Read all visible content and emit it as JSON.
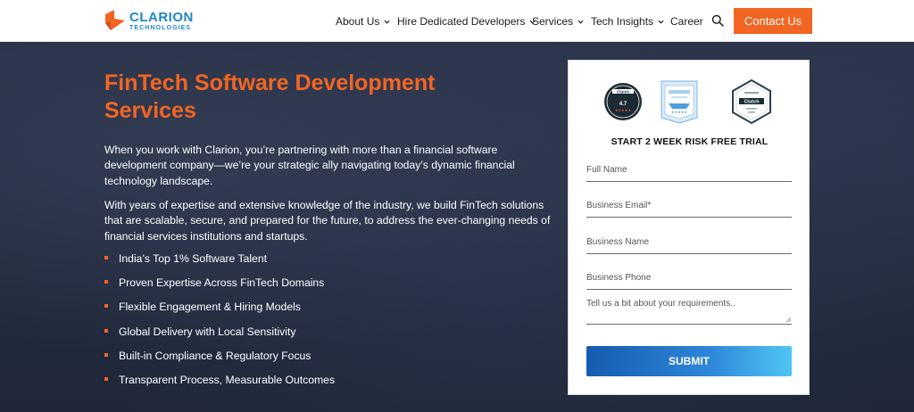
{
  "brand": {
    "name": "CLARION",
    "tagline": "TECHNOLOGIES",
    "accent": "#f26522",
    "primary": "#1e86c9"
  },
  "nav": {
    "items": [
      {
        "label": "About Us",
        "has_dropdown": true
      },
      {
        "label": "Hire Dedicated Developers",
        "has_dropdown": true
      },
      {
        "label": "Services",
        "has_dropdown": true
      },
      {
        "label": "Tech Insights",
        "has_dropdown": true
      },
      {
        "label": "Career",
        "has_dropdown": false
      }
    ],
    "search_icon": "search-icon",
    "contact_label": "Contact Us"
  },
  "hero": {
    "title": "FinTech Software Development Services",
    "paragraphs": [
      "When you work with Clarion, you’re partnering with more than a financial software development company—we’re your strategic ally navigating today’s dynamic financial technology landscape.",
      "With years of expertise and extensive knowledge of the industry, we build FinTech solutions that are scalable, secure, and prepared for the future, to address the ever-changing needs of financial services institutions and startups."
    ],
    "features": [
      "India’s Top 1% Software Talent",
      "Proven Expertise Across FinTech Domains",
      "Flexible Engagement & Hiring Models",
      "Global Delivery with Local Sensitivity",
      "Built-in Compliance & Regulatory Focus",
      "Transparent Process, Measurable Outcomes"
    ]
  },
  "form": {
    "badges": [
      {
        "name": "clutch-rating-badge",
        "label": "Clutch",
        "rating": "4.7"
      },
      {
        "name": "award-ribbon-badge",
        "label": ""
      },
      {
        "name": "clutch-top-developers-badge",
        "label": "Clutch"
      }
    ],
    "heading": "START 2 WEEK RISK FREE TRIAL",
    "fields": {
      "full_name": {
        "placeholder": "Full Name",
        "value": ""
      },
      "email": {
        "placeholder": "Business Email*",
        "value": ""
      },
      "business_name": {
        "placeholder": "Business Name",
        "value": ""
      },
      "phone": {
        "placeholder": "Business Phone",
        "value": ""
      },
      "requirements": {
        "placeholder": "Tell us a bit about your requirements..",
        "value": ""
      }
    },
    "submit_label": "SUBMIT"
  }
}
